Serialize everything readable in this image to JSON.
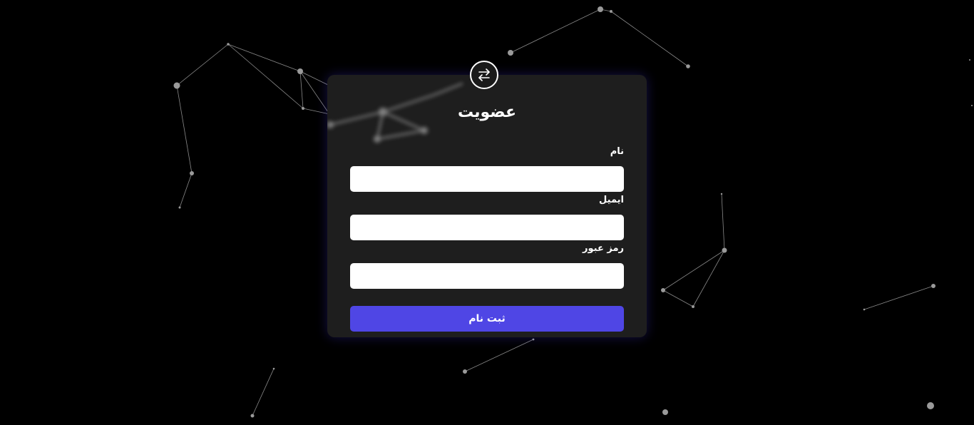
{
  "form": {
    "title": "عضویت",
    "name_label": "نام",
    "name_value": "",
    "email_label": "ایمیل",
    "email_value": "",
    "password_label": "رمز عبور",
    "password_value": "",
    "submit_label": "ثبت نام",
    "badge_icon": "swap-arrows-icon"
  },
  "colors": {
    "background": "#000000",
    "card": "#1e1e1e",
    "accent": "#4f46e5",
    "particle": "#9a9a9a"
  }
}
